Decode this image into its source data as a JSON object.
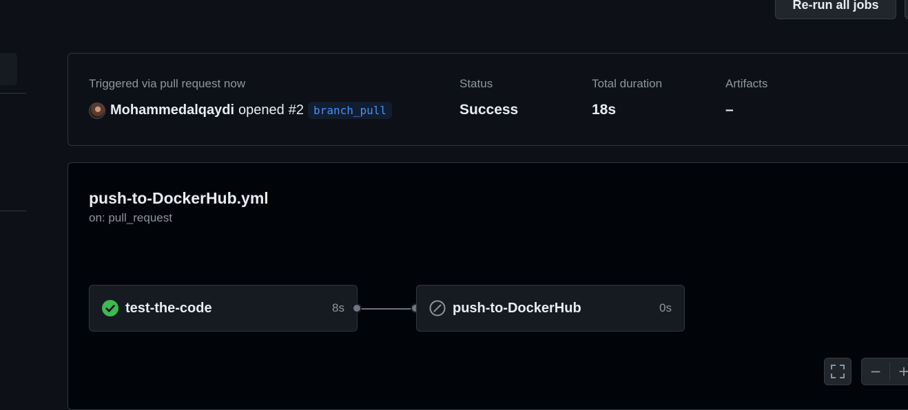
{
  "header": {
    "rerun_label": "Re-run all jobs"
  },
  "summary": {
    "trigger_label": "Triggered via pull request now",
    "username": "Mohammedalqaydi",
    "action": "opened",
    "pr_number": "#2",
    "branch": "branch_pull",
    "status_label": "Status",
    "status_value": "Success",
    "duration_label": "Total duration",
    "duration_value": "18s",
    "artifacts_label": "Artifacts",
    "artifacts_value": "–"
  },
  "workflow": {
    "filename": "push-to-DockerHub.yml",
    "trigger": "on: pull_request",
    "jobs": [
      {
        "name": "test-the-code",
        "duration": "8s",
        "status": "success",
        "icon": "check-circle-icon"
      },
      {
        "name": "push-to-DockerHub",
        "duration": "0s",
        "status": "skipped",
        "icon": "skip-icon"
      }
    ]
  },
  "controls": {
    "fullscreen_icon": "fullscreen-icon",
    "zoom_out_icon": "minus-icon",
    "zoom_in_icon": "plus-icon"
  },
  "colors": {
    "success": "#3fb950",
    "link": "#4493f8",
    "background": "#0d1117"
  }
}
